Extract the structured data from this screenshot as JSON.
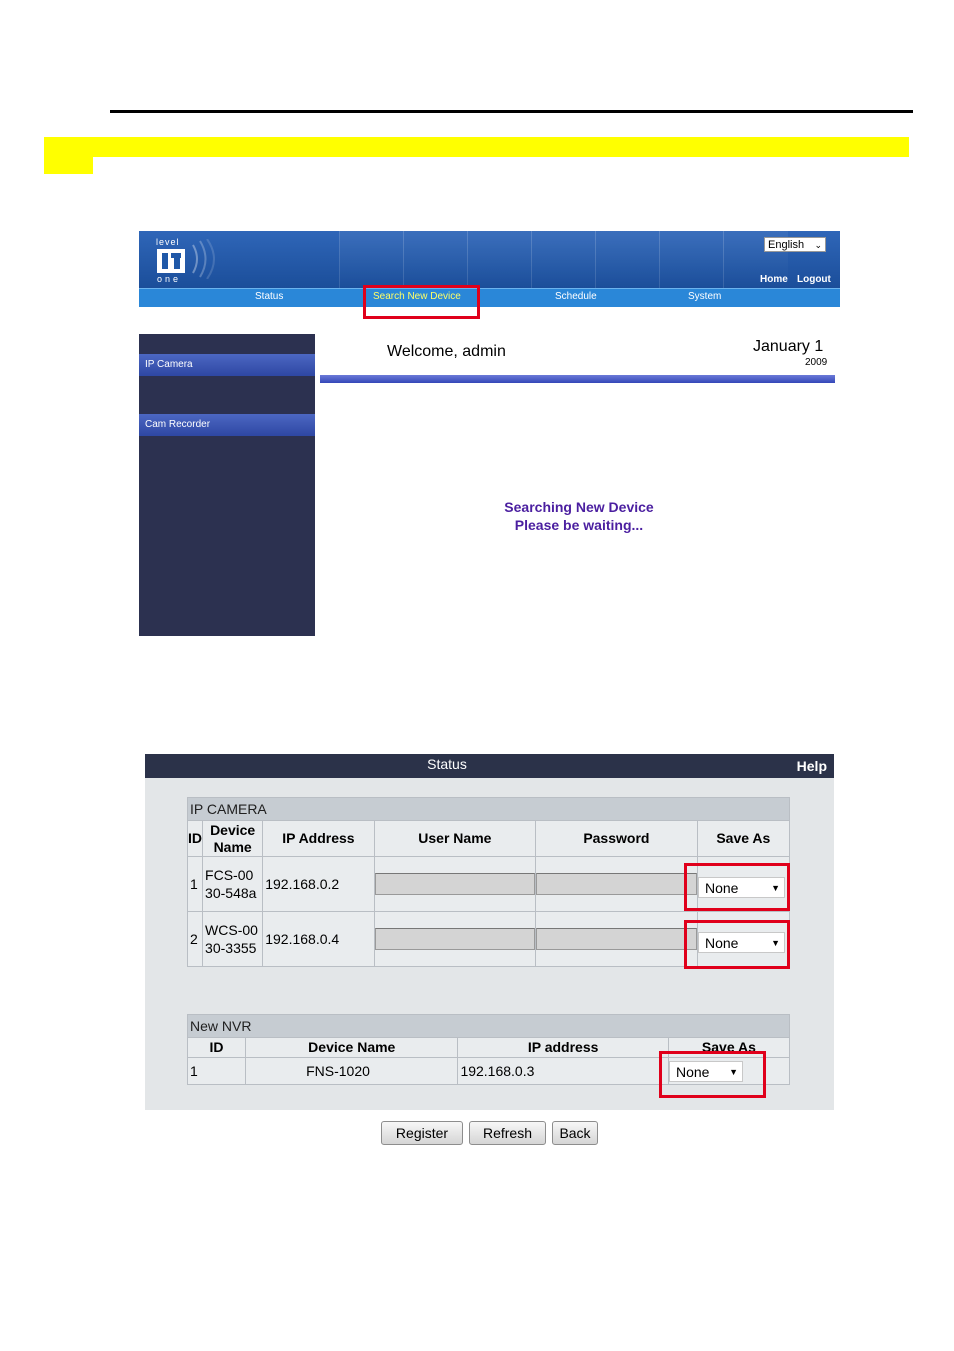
{
  "app": {
    "logo_top": "level",
    "logo_bottom": "one",
    "language": "English",
    "links": {
      "home": "Home",
      "logout": "Logout"
    },
    "nav": [
      {
        "label": "Status"
      },
      {
        "label": "Search New Device",
        "active": true
      },
      {
        "label": "Schedule"
      },
      {
        "label": "System"
      }
    ],
    "sidebar": [
      {
        "label": "IP Camera"
      },
      {
        "label": "Cam Recorder"
      }
    ],
    "welcome": "Welcome, admin",
    "date_main": "January 1",
    "date_year": "2009",
    "searching_line1": "Searching New Device",
    "searching_line2": "Please be waiting..."
  },
  "status_panel": {
    "title": "Status",
    "help": "Help",
    "ip_camera": {
      "caption": "IP CAMERA",
      "headers": {
        "id": "ID",
        "device_name": "Device Name",
        "ip": "IP Address",
        "user": "User Name",
        "password": "Password",
        "save_as": "Save As"
      },
      "rows": [
        {
          "id": "1",
          "device_name": "FCS-0030-548a",
          "ip": "192.168.0.2",
          "save_as": "None"
        },
        {
          "id": "2",
          "device_name": "WCS-0030-3355",
          "ip": "192.168.0.4",
          "save_as": "None"
        }
      ]
    },
    "new_nvr": {
      "caption": "New NVR",
      "headers": {
        "id": "ID",
        "device_name": "Device Name",
        "ip": "IP address",
        "save_as": "Save As"
      },
      "rows": [
        {
          "id": "1",
          "device_name": "FNS-1020",
          "ip": "192.168.0.3",
          "save_as": "None"
        }
      ]
    }
  },
  "buttons": {
    "register": "Register",
    "refresh": "Refresh",
    "back": "Back"
  },
  "colors": {
    "highlight": "#ffff00",
    "annotation_red": "#e0001b",
    "banner_blue": "#1f58a8",
    "nav_active": "#ffff66",
    "search_text": "#4b1fa0"
  }
}
